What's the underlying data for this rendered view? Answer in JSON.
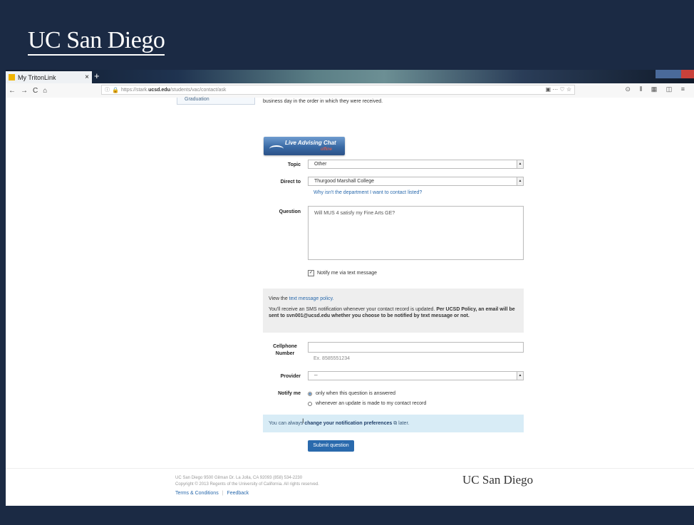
{
  "slide": {
    "logo": "UC San Diego"
  },
  "browser": {
    "tab_title": "My TritonLink",
    "tab_close": "×",
    "new_tab": "+",
    "nav": {
      "back": "←",
      "forward": "→",
      "reload": "C",
      "home": "⌂"
    },
    "url_prefix": "https://stark.",
    "url_domain": "ucsd.edu",
    "url_path": "/students/vac/contact/ask",
    "url_actions": "▣ ··· ♡ ☆",
    "toolbar_icons": "⊙ ⫴ ▦ ◫ ≡"
  },
  "page": {
    "sidebar_item": "Graduation",
    "intro_text": "business day in the order in which they were received.",
    "chat": {
      "title": "Live Advising Chat",
      "status": "offline"
    },
    "form": {
      "topic_label": "Topic",
      "topic_value": "Other",
      "direct_label": "Direct to",
      "direct_value": "Thurgood Marshall College",
      "why_link": "Why isn't the department I want to contact listed?",
      "question_label": "Question",
      "question_value": "Will MUS 4 satisfy my Fine Arts GE?",
      "notify_text_label": "Notify me via text message",
      "sms_policy_prefix": "View the ",
      "sms_policy_link": "text message policy.",
      "sms_info_plain": "You'll receive an SMS notification whenever your contact record is updated. ",
      "sms_info_bold": "Per UCSD Policy, an email will be sent to svn001@ucsd.edu whether you choose to be notified by text message or not.",
      "cell_label_1": "Cellphone",
      "cell_label_2": "Number",
      "cell_hint": "Ex. 8585551234",
      "provider_label": "Provider",
      "provider_value": "--",
      "notify_label": "Notify me",
      "notify_option_1": "only when this question is answered",
      "notify_option_2": "whenever an update is made to my contact record",
      "pref_prefix": "You can always ",
      "pref_bold": "change your notification preferences",
      "pref_suffix": " later.",
      "submit_label": "Submit question"
    },
    "footer": {
      "address": "UC San Diego 9500 Gilman Dr. La Jolla, CA 92093 (858) 534-2230",
      "copyright": "Copyright © 2013 Regents of the University of California. All rights reserved.",
      "terms": "Terms & Conditions",
      "separator": "|",
      "feedback": "Feedback",
      "logo": "UC San Diego"
    }
  }
}
